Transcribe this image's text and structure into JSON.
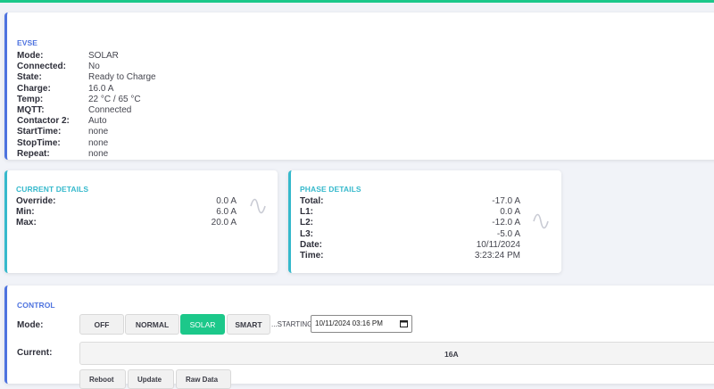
{
  "evse": {
    "title": "EVSE",
    "rows": [
      {
        "k": "Mode:",
        "v": "SOLAR"
      },
      {
        "k": "Connected:",
        "v": "No"
      },
      {
        "k": "State:",
        "v": "Ready to Charge"
      },
      {
        "k": "Charge:",
        "v": "16.0 A"
      },
      {
        "k": "Temp:",
        "v": "22 °C / 65 °C"
      },
      {
        "k": "MQTT:",
        "v": "Connected"
      },
      {
        "k": "Contactor 2:",
        "v": "Auto"
      },
      {
        "k": "StartTime:",
        "v": "none"
      },
      {
        "k": "StopTime:",
        "v": "none"
      },
      {
        "k": "Repeat:",
        "v": "none"
      }
    ]
  },
  "current": {
    "title": "CURRENT DETAILS",
    "rows": [
      {
        "k": "Override:",
        "v": "0.0 A"
      },
      {
        "k": "Min:",
        "v": "6.0 A"
      },
      {
        "k": "Max:",
        "v": "20.0 A"
      }
    ],
    "icon": "sine-wave-icon"
  },
  "phase": {
    "title": "PHASE DETAILS",
    "rows": [
      {
        "k": "Total:",
        "v": "-17.0 A"
      },
      {
        "k": "L1:",
        "v": "0.0 A"
      },
      {
        "k": "L2:",
        "v": "-12.0 A"
      },
      {
        "k": "L3:",
        "v": "-5.0 A"
      },
      {
        "k": "Date:",
        "v": "10/11/2024"
      },
      {
        "k": "Time:",
        "v": "3:23:24 PM"
      }
    ],
    "icon": "sine-wave-icon"
  },
  "control": {
    "title": "CONTROL",
    "mode_label": "Mode:",
    "modes": [
      "OFF",
      "NORMAL",
      "SOLAR",
      "SMART"
    ],
    "active_mode": "SOLAR",
    "starting_label": "...STARTING:",
    "starting_value": "10/11/2024 03:16 PM",
    "current_label": "Current:",
    "current_value": "16A",
    "actions": [
      "Reboot",
      "Update",
      "Raw Data"
    ]
  },
  "colors": {
    "accent_green": "#1cc88a",
    "primary_blue": "#4e73df",
    "info_teal": "#36b9cc"
  }
}
